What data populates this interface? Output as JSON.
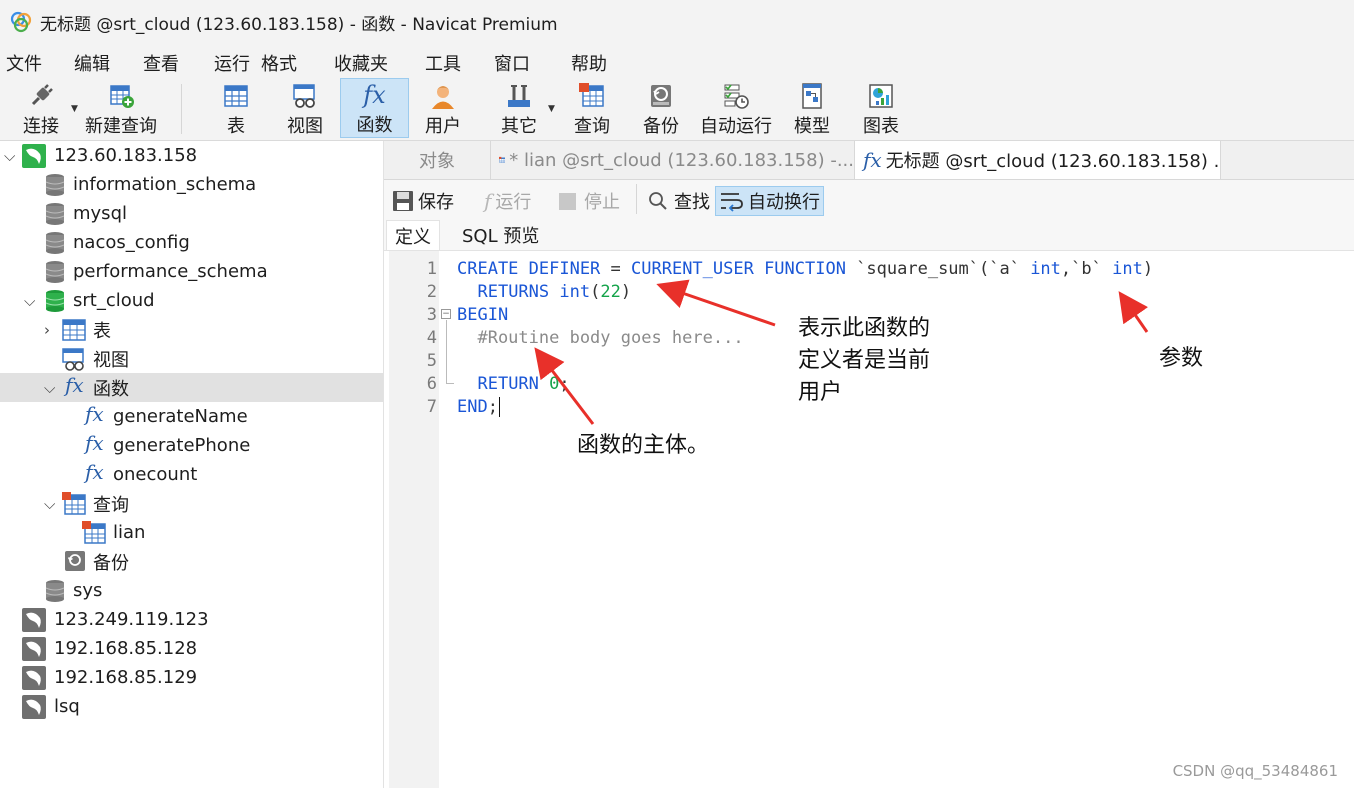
{
  "window": {
    "title": "无标题 @srt_cloud (123.60.183.158) - 函数 - Navicat Premium"
  },
  "menu": [
    "文件",
    "编辑",
    "查看",
    "运行",
    "格式",
    "收藏夹",
    "工具",
    "窗口",
    "帮助"
  ],
  "toolbar": {
    "connect": "连接",
    "new_query": "新建查询",
    "table": "表",
    "view": "视图",
    "function": "函数",
    "user": "用户",
    "other": "其它",
    "query": "查询",
    "backup": "备份",
    "auto_run": "自动运行",
    "model": "模型",
    "chart": "图表"
  },
  "sidebar": {
    "conn1": "123.60.183.158",
    "db_information_schema": "information_schema",
    "db_mysql": "mysql",
    "db_nacos_config": "nacos_config",
    "db_performance_schema": "performance_schema",
    "db_srt_cloud": "srt_cloud",
    "node_table": "表",
    "node_view": "视图",
    "node_function": "函数",
    "fn_generateName": "generateName",
    "fn_generatePhone": "generatePhone",
    "fn_onecount": "onecount",
    "node_query": "查询",
    "query_lian": "lian",
    "node_backup": "备份",
    "db_sys": "sys",
    "conn2": "123.249.119.123",
    "conn3": "192.168.85.128",
    "conn4": "192.168.85.129",
    "conn5": "lsq"
  },
  "tabs": {
    "objects": "对象",
    "lian": "* lian @srt_cloud (123.60.183.158) -...",
    "untitled": "无标题 @srt_cloud (123.60.183.158) ..."
  },
  "edit_toolbar": {
    "save": "保存",
    "run": "运行",
    "stop": "停止",
    "find": "查找",
    "wrap": "自动换行"
  },
  "subtabs": {
    "definition": "定义",
    "sql_preview": "SQL 预览"
  },
  "code": {
    "line_numbers": [
      "1",
      "2",
      "3",
      "4",
      "5",
      "6",
      "7"
    ],
    "l1_create": "CREATE DEFINER",
    "l1_eq": " = ",
    "l1_current_user": "CURRENT_USER FUNCTION",
    "l1_name": " `square_sum`(`a` ",
    "l1_int1": "int",
    "l1_b": ",`b` ",
    "l1_int2": "int",
    "l1_close": ")",
    "l2_indent": "  ",
    "l2_returns": "RETURNS int",
    "l2_paren_open": "(",
    "l2_num": "22",
    "l2_paren_close": ")",
    "l3_begin": "BEGIN",
    "l4_comment": "  #Routine body goes here...",
    "l6_indent": "  ",
    "l6_return": "RETURN ",
    "l6_num": "0",
    "l6_semi": ";",
    "l7_end": "END",
    "l7_semi": ";"
  },
  "annotations": {
    "definer_line1": "表示此函数的",
    "definer_line2": "定义者是当前",
    "definer_line3": "用户",
    "params": "参数",
    "body": "函数的主体。"
  },
  "watermark": "CSDN @qq_53484861",
  "colors": {
    "keyword": "#1a56d6",
    "number": "#15a34a",
    "comment": "#8a8a8a",
    "arrow": "#e8302a",
    "selection": "#cce4f7"
  }
}
